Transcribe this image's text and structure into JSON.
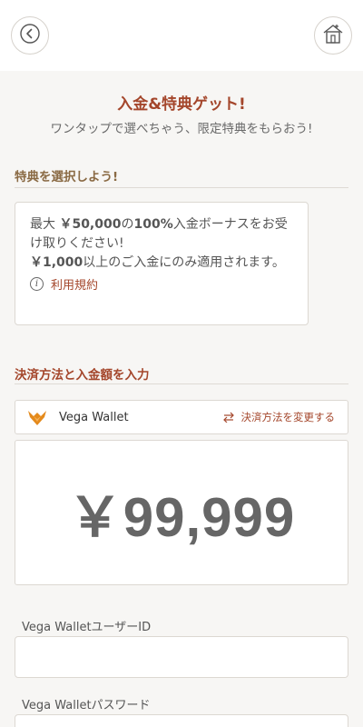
{
  "header": {
    "back_icon": "chevron-left-icon",
    "home_icon": "home-icon"
  },
  "hero": {
    "title": "入金&特典ゲット!",
    "subtitle": "ワンタップで選べちゃう、限定特典をもらおう!"
  },
  "bonus_section": {
    "title": "特典を選択しよう!",
    "card": {
      "line1_prefix": "最大 ",
      "line1_amount": "￥50,000",
      "line1_mid": "の",
      "line1_percent": "100%",
      "line1_suffix": "入金ボーナスをお受け取りください!",
      "line2_amount": "￥1,000",
      "line2_suffix": "以上のご入金にのみ適用されます。",
      "terms_label": "利用規約",
      "terms_icon": "info-icon"
    }
  },
  "payment_section": {
    "title": "決済方法と入金額を入力",
    "method_name": "Vega Wallet",
    "method_logo": "vega-wallet-logo",
    "change_label": "決済方法を変更する",
    "change_icon": "swap-arrows-icon",
    "amount": "￥99,999"
  },
  "fields": {
    "user_id_label": "Vega WalletユーザーID",
    "user_id_value": "",
    "password_label": "Vega Walletパスワード",
    "password_value": ""
  },
  "colors": {
    "accent": "#a4462b",
    "section_gold": "#8a6a44",
    "background": "#f7f6f4"
  }
}
